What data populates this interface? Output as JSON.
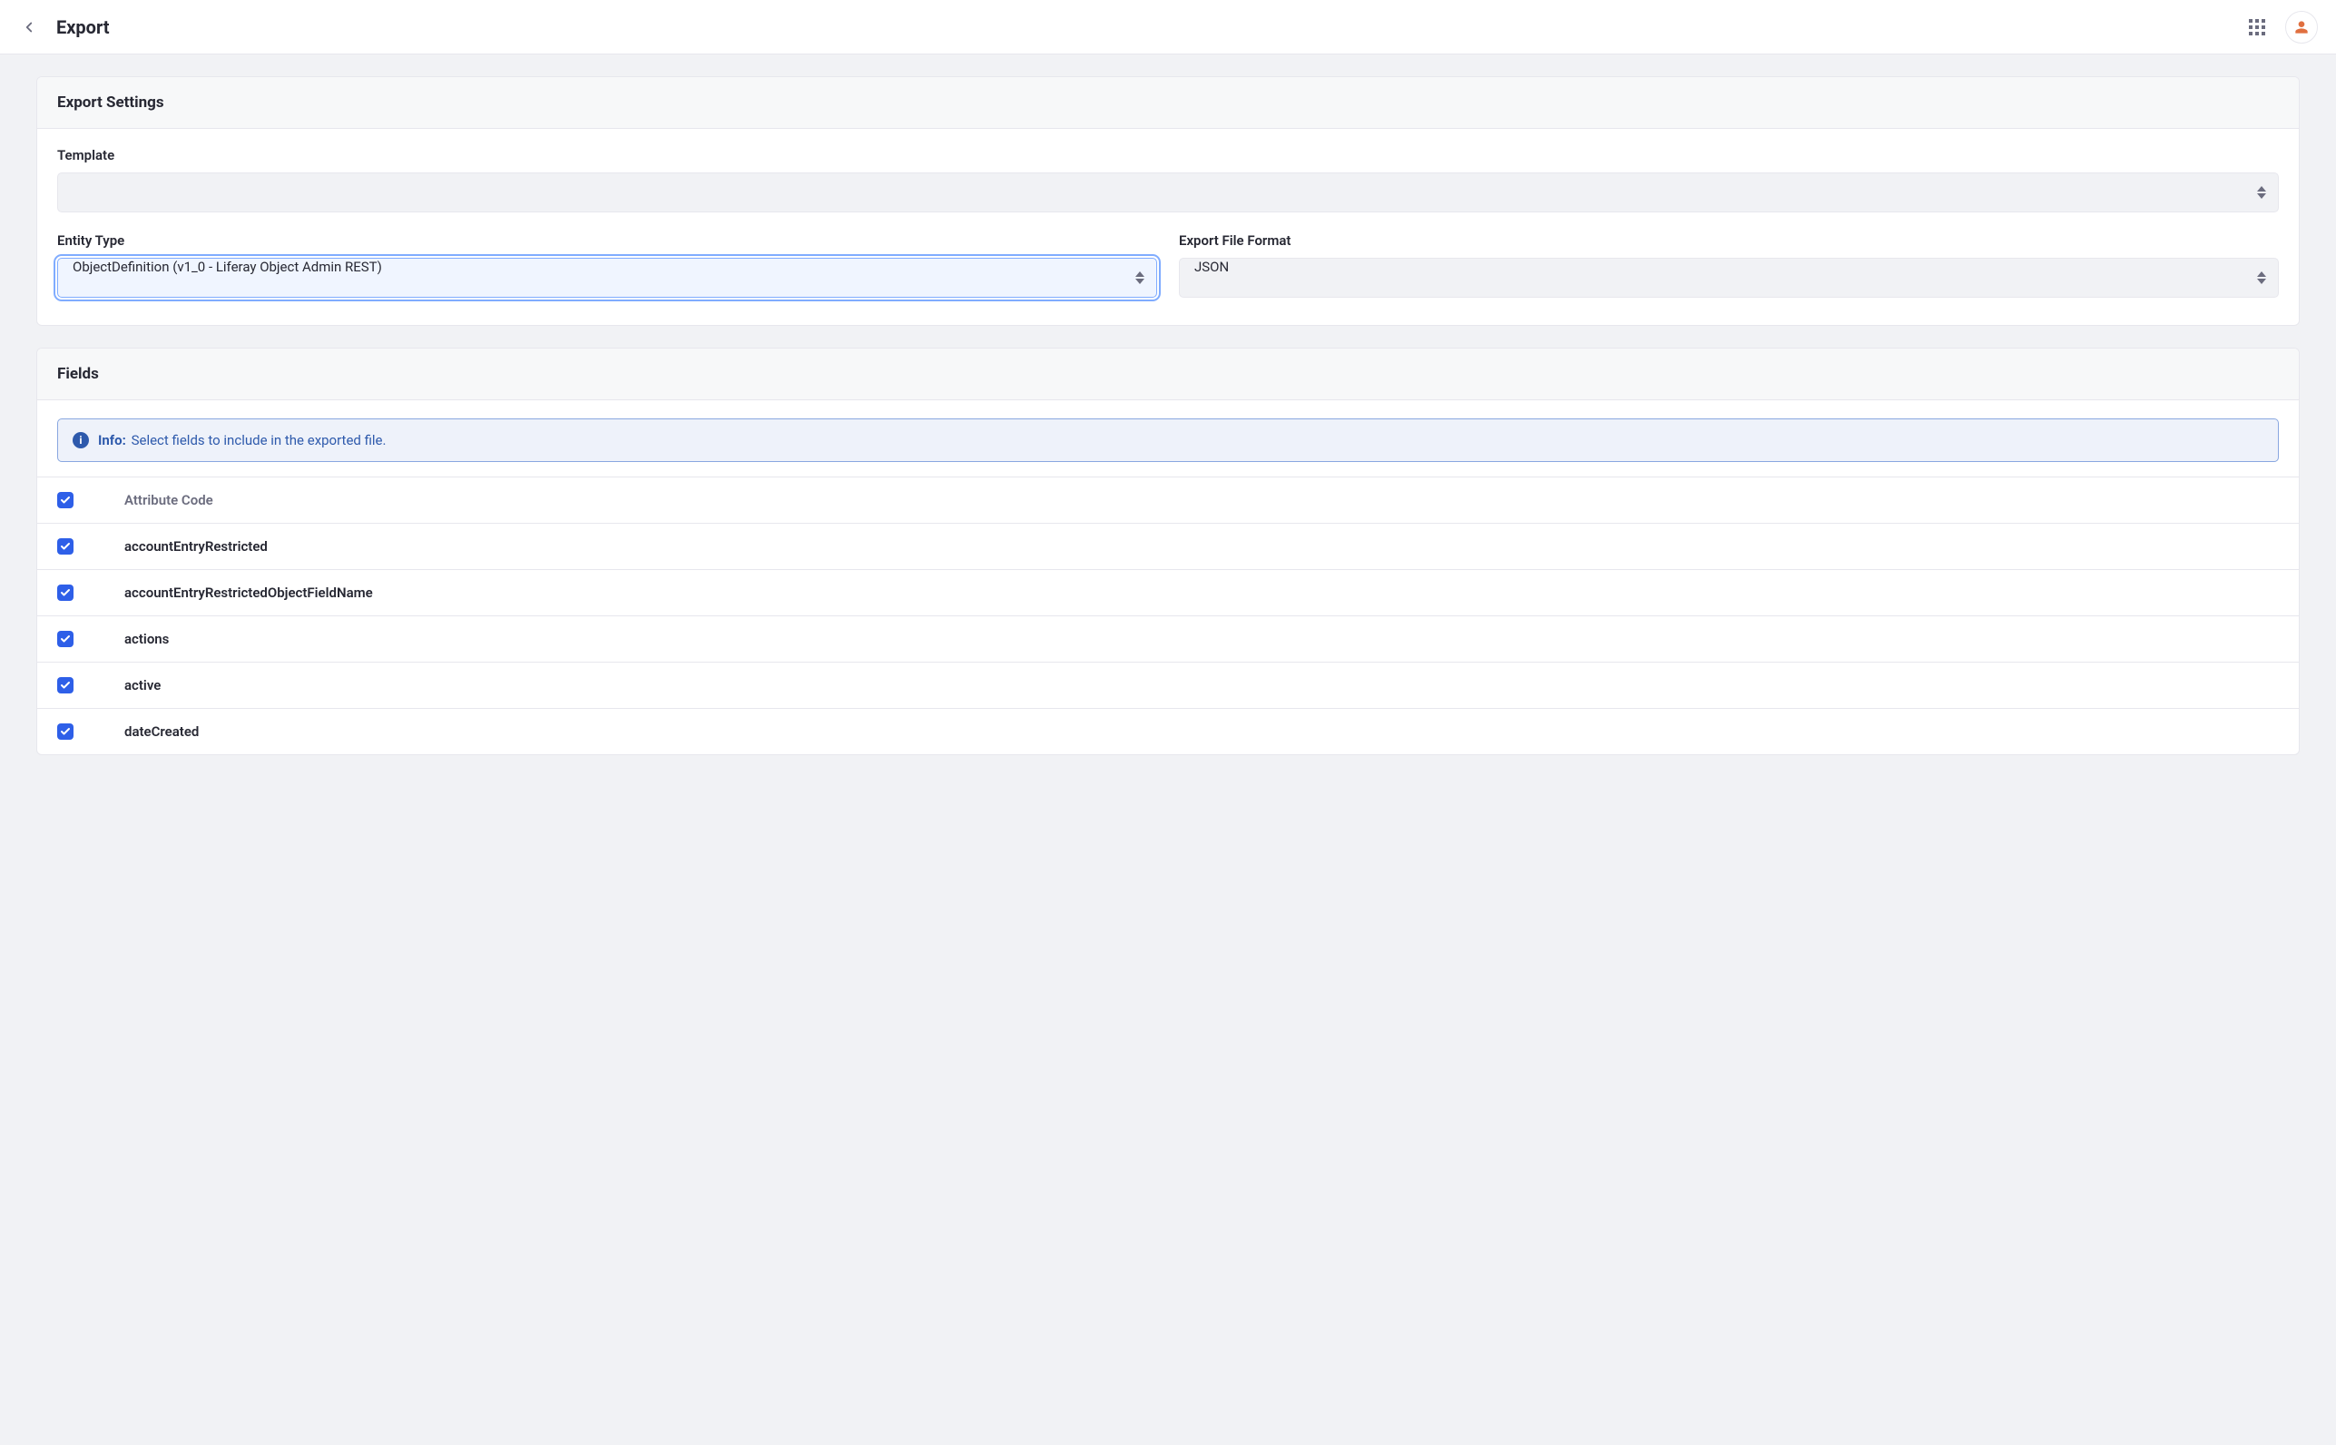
{
  "header": {
    "title": "Export"
  },
  "settingsPanel": {
    "title": "Export Settings",
    "template": {
      "label": "Template",
      "value": ""
    },
    "entityType": {
      "label": "Entity Type",
      "value": "ObjectDefinition (v1_0 - Liferay Object Admin REST)"
    },
    "exportFormat": {
      "label": "Export File Format",
      "value": "JSON"
    }
  },
  "fieldsPanel": {
    "title": "Fields",
    "info": {
      "label": "Info:",
      "message": "Select fields to include in the exported file."
    },
    "columnHeader": "Attribute Code",
    "fields": [
      {
        "name": "accountEntryRestricted",
        "checked": true
      },
      {
        "name": "accountEntryRestrictedObjectFieldName",
        "checked": true
      },
      {
        "name": "actions",
        "checked": true
      },
      {
        "name": "active",
        "checked": true
      },
      {
        "name": "dateCreated",
        "checked": true
      }
    ]
  }
}
